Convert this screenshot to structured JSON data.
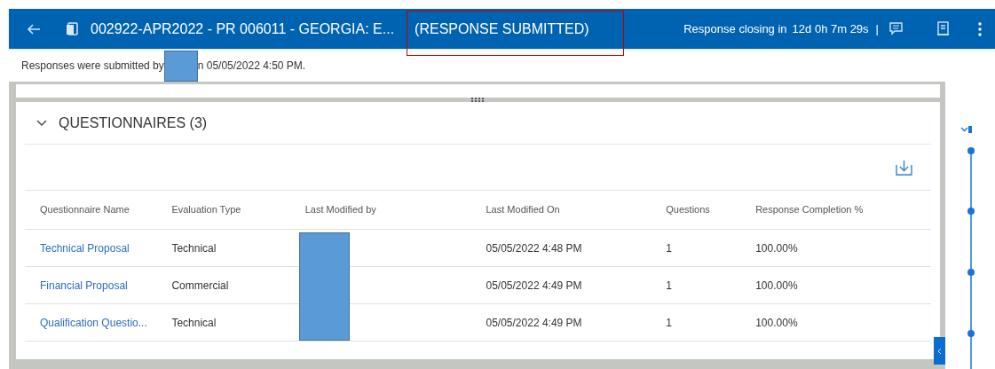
{
  "header": {
    "title": "002922-APR2022 - PR 006011 - GEORGIA: E...",
    "status": "(RESPONSE SUBMITTED)",
    "closing_label": "Response closing in",
    "countdown": "12d 0h 7m 29s",
    "separator": "|"
  },
  "notice": {
    "before_redaction": "Responses were submitted by",
    "after_redaction": "n 05/05/2022 4:50 PM."
  },
  "section": {
    "title": "QUESTIONNAIRES (3)",
    "expanded": true
  },
  "table": {
    "columns": [
      "Questionnaire Name",
      "Evaluation Type",
      "Last Modified by",
      "Last Modified On",
      "Questions",
      "Response Completion %"
    ],
    "rows": [
      {
        "name": "Technical Proposal",
        "evaluation_type": "Technical",
        "modified_on": "05/05/2022 4:48 PM",
        "questions": "1",
        "completion": "100.00%"
      },
      {
        "name": "Financial Proposal",
        "evaluation_type": "Commercial",
        "modified_on": "05/05/2022 4:49 PM",
        "questions": "1",
        "completion": "100.00%"
      },
      {
        "name": "Qualification Questio...",
        "evaluation_type": "Technical",
        "modified_on": "05/05/2022 4:49 PM",
        "questions": "1",
        "completion": "100.00%"
      }
    ]
  }
}
